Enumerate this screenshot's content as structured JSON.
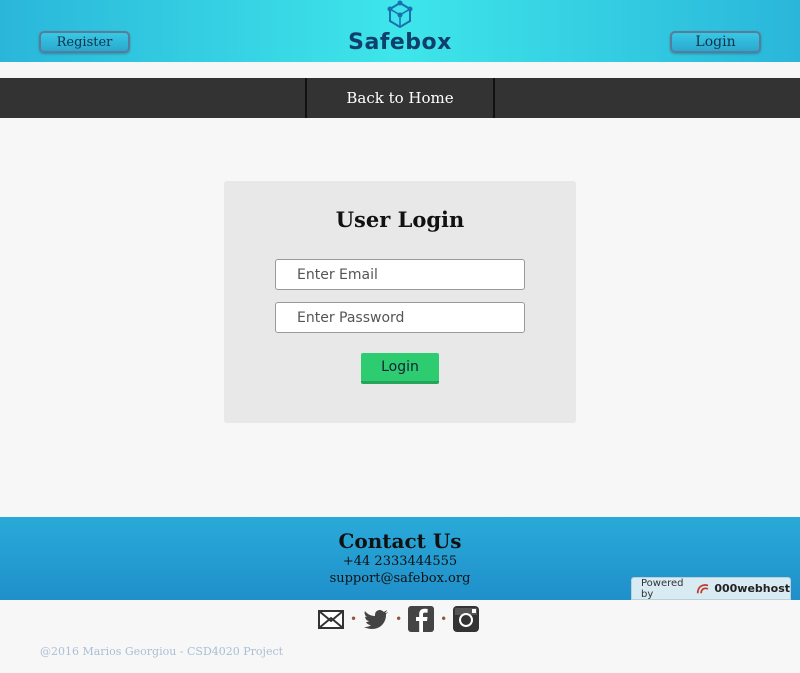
{
  "header": {
    "logo_text": "Safebox",
    "register_label": "Register",
    "login_label": "Login"
  },
  "nav": {
    "home_label": "Back to Home"
  },
  "login_card": {
    "title": "User Login",
    "email_placeholder": "Enter Email",
    "email_value": "",
    "password_placeholder": "Enter Password",
    "password_value": "",
    "submit_label": "Login"
  },
  "footer": {
    "title": "Contact Us",
    "phone": "+44 2333444555",
    "email": "support@safebox.org",
    "powered_prefix": "Powered by",
    "powered_brand": "000webhost"
  },
  "social": {
    "icons": [
      "envelope-icon",
      "twitter-icon",
      "facebook-icon",
      "instagram-icon"
    ],
    "separator": "•"
  },
  "copyright": "@2016 Marios Georgiou - CSD4020 Project",
  "colors": {
    "header_gradient_center": "#3ee6ea",
    "header_gradient_edge": "#2ab6da",
    "nav_bg": "#333333",
    "login_button": "#2ecc71",
    "footer_bg": "#1f8fca"
  }
}
